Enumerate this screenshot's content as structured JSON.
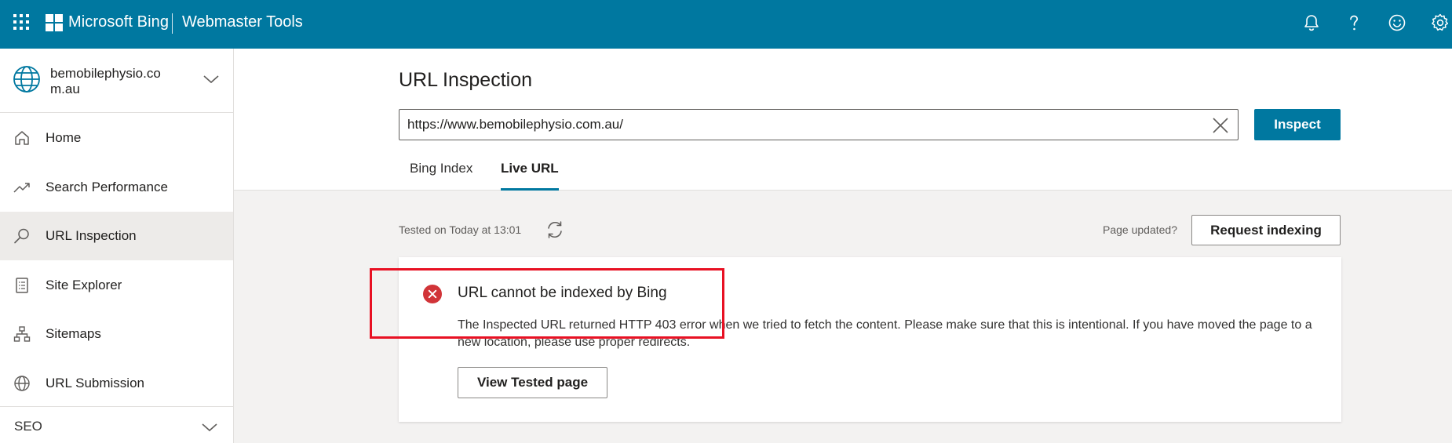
{
  "topbar": {
    "brand": "Microsoft Bing",
    "product": "Webmaster Tools",
    "icons": [
      "waffle-icon",
      "notification-icon",
      "help-icon",
      "feedback-icon",
      "settings-icon"
    ]
  },
  "sidebar": {
    "site_name": "bemobilephysio.com.au",
    "items": [
      {
        "label": "Home",
        "icon": "home-icon"
      },
      {
        "label": "Search Performance",
        "icon": "trend-icon"
      },
      {
        "label": "URL Inspection",
        "icon": "search-icon",
        "active": true
      },
      {
        "label": "Site Explorer",
        "icon": "document-list-icon"
      },
      {
        "label": "Sitemaps",
        "icon": "sitemap-icon"
      },
      {
        "label": "URL Submission",
        "icon": "globe-icon"
      }
    ],
    "section": "SEO"
  },
  "main": {
    "title": "URL Inspection",
    "url_value": "https://www.bemobilephysio.com.au/",
    "inspect_label": "Inspect",
    "tabs": [
      {
        "label": "Bing Index",
        "active": false
      },
      {
        "label": "Live URL",
        "active": true
      }
    ],
    "tested_text": "Tested on Today at 13:01",
    "page_updated": "Page updated?",
    "request_label": "Request indexing",
    "result": {
      "title": "URL cannot be indexed by Bing",
      "description": "The Inspected URL returned HTTP 403 error when we tried to fetch the content. Please make sure that this is intentional. If you have moved the page to a new location, please use proper redirects.",
      "button_label": "View Tested page",
      "status_color": "#d13438"
    }
  },
  "colors": {
    "accent": "#0078a0",
    "highlight": "#e81123"
  }
}
